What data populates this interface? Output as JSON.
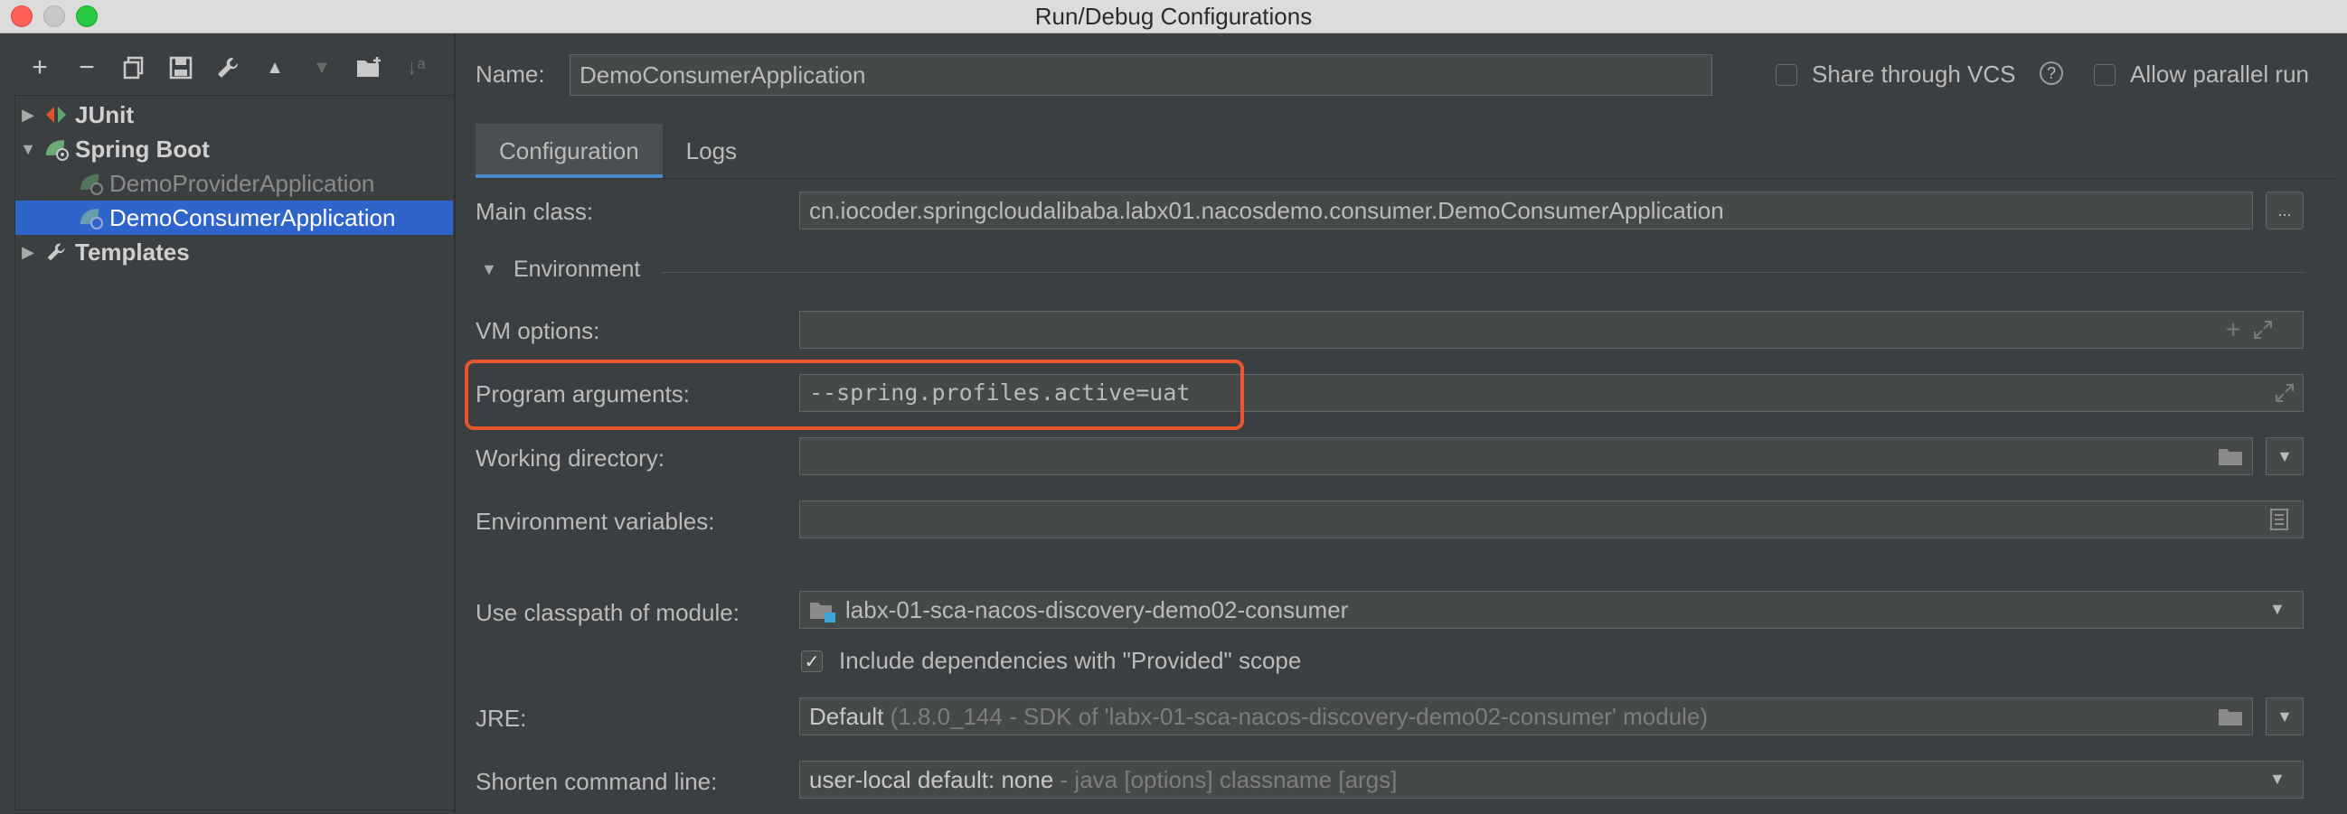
{
  "window": {
    "title": "Run/Debug Configurations"
  },
  "toolbar": {
    "add": "+",
    "remove": "−",
    "copy": "⧉",
    "save": "🖫",
    "edit": "🔧",
    "up": "▲",
    "down": "▼",
    "folder": "📁",
    "sort": "↓ᵃ"
  },
  "tree": {
    "junit": {
      "arrow": "▶",
      "label": "JUnit"
    },
    "spring_boot": {
      "arrow": "▼",
      "label": "Spring Boot"
    },
    "provider": {
      "label": "DemoProviderApplication"
    },
    "consumer": {
      "label": "DemoConsumerApplication"
    },
    "templates": {
      "arrow": "▶",
      "label": "Templates"
    }
  },
  "header": {
    "name_label": "Name:",
    "name_value": "DemoConsumerApplication",
    "share_vcs": {
      "label": "Share through VCS",
      "checked": false,
      "help": "?"
    },
    "allow_parallel": {
      "label": "Allow parallel run",
      "checked": false
    }
  },
  "tabs": [
    {
      "label": "Configuration",
      "active": true
    },
    {
      "label": "Logs",
      "active": false
    }
  ],
  "form": {
    "main_class": {
      "label": "Main class:",
      "value": "cn.iocoder.springcloudalibaba.labx01.nacosdemo.consumer.DemoConsumerApplication",
      "button": "..."
    },
    "environment": {
      "arrow": "▼",
      "label": "Environment"
    },
    "vm_options": {
      "label": "VM options:",
      "value": ""
    },
    "program_args": {
      "label": "Program arguments:",
      "value": "--spring.profiles.active=uat"
    },
    "working_dir": {
      "label": "Working directory:",
      "value": ""
    },
    "env_vars": {
      "label": "Environment variables:",
      "value": ""
    },
    "classpath": {
      "label": "Use classpath of module:",
      "value": "labx-01-sca-nacos-discovery-demo02-consumer"
    },
    "include_deps": {
      "label": "Include dependencies with \"Provided\" scope",
      "checked": true
    },
    "jre": {
      "label": "JRE:",
      "value": "Default",
      "hint": "(1.8.0_144 - SDK of 'labx-01-sca-nacos-discovery-demo02-consumer' module)"
    },
    "shorten": {
      "label": "Shorten command line:",
      "value": "user-local default: none",
      "hint": "- java [options] classname [args]"
    }
  },
  "colors": {
    "accent": "#2f65ca",
    "highlight": "#e8552f",
    "tab_underline": "#4a88c7"
  }
}
